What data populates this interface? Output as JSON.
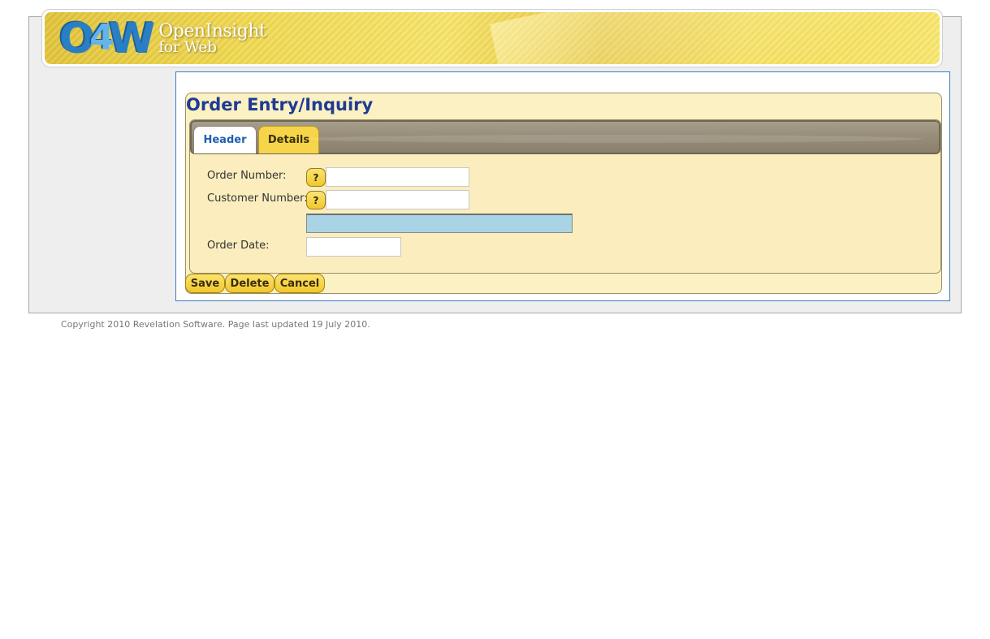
{
  "banner": {
    "logo_mark": "O4W",
    "logo_line1": "OpenInsight",
    "logo_line2": "for Web"
  },
  "form": {
    "title": "Order Entry/Inquiry",
    "tabs": [
      {
        "label": "Header",
        "active": true
      },
      {
        "label": "Details",
        "active": false
      }
    ],
    "fields": {
      "order_number": {
        "label": "Order Number:",
        "value": ""
      },
      "customer_number": {
        "label": "Customer Number:",
        "value": ""
      },
      "customer_description": {
        "value": ""
      },
      "order_date": {
        "label": "Order Date:",
        "value": ""
      }
    },
    "help_label": "?",
    "buttons": {
      "save": "Save",
      "delete": "Delete",
      "cancel": "Cancel"
    }
  },
  "footer": {
    "text": "Copyright 2010 Revelation Software. Page last updated 19 July 2010."
  },
  "colors": {
    "accent_yellow": "#f6d54a",
    "title_blue": "#1f3b93",
    "panel_bg": "#fbf1c3",
    "content_border": "#3a7fc1",
    "description_box": "#a9d4e6"
  }
}
